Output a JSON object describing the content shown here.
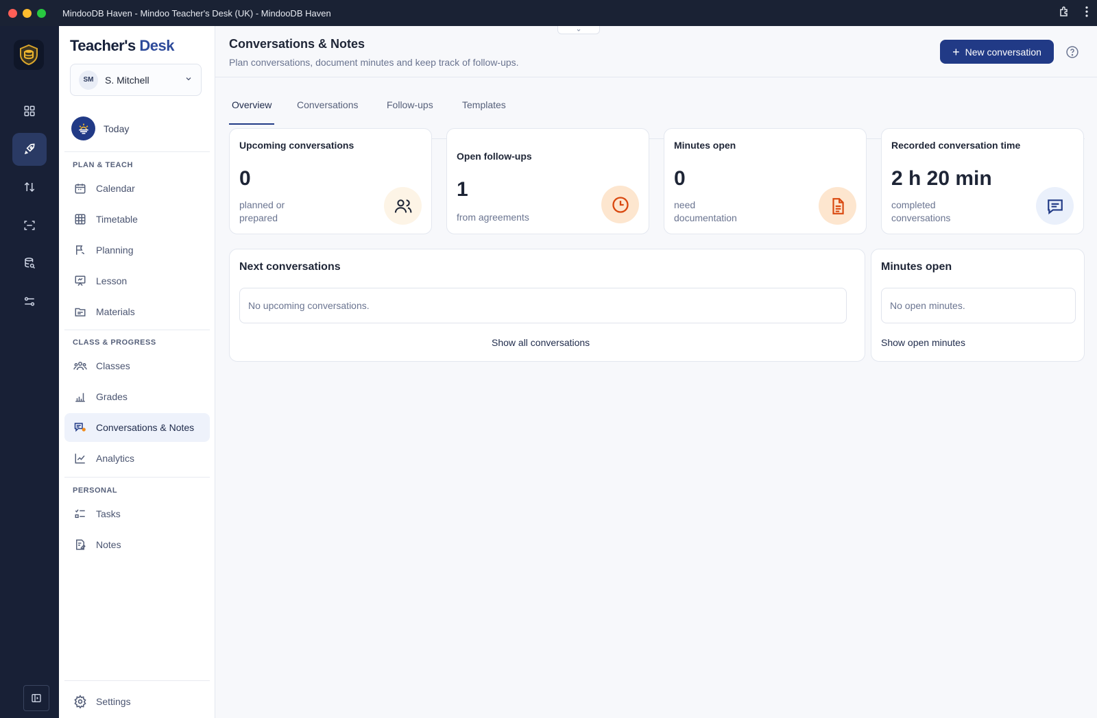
{
  "window": {
    "title": "MindooDB Haven - Mindoo Teacher's Desk (UK) - MindooDB Haven"
  },
  "brand": {
    "part1": "Teacher's",
    "part2": "Desk"
  },
  "user": {
    "initials": "SM",
    "name": "S. Mitchell"
  },
  "sidebar": {
    "today": "Today",
    "sections": {
      "plan": "PLAN & TEACH",
      "class": "CLASS & PROGRESS",
      "personal": "PERSONAL"
    },
    "plan_items": [
      "Calendar",
      "Timetable",
      "Planning",
      "Lesson",
      "Materials"
    ],
    "class_items": [
      "Classes",
      "Grades",
      "Conversations & Notes",
      "Analytics"
    ],
    "personal_items": [
      "Tasks",
      "Notes"
    ],
    "settings": "Settings"
  },
  "header": {
    "title": "Conversations & Notes",
    "subtitle": "Plan conversations, document minutes and keep track of follow-ups.",
    "new_button": "New conversation"
  },
  "tabs": [
    "Overview",
    "Conversations",
    "Follow-ups",
    "Templates"
  ],
  "stats": [
    {
      "label": "Upcoming conversations",
      "value": "0",
      "sub": "planned or prepared",
      "icon": "users-icon",
      "icon_color": "#1e2536",
      "icon_bg": "#fdf4e6"
    },
    {
      "label": "Open follow-ups",
      "value": "1",
      "sub": "from agreements",
      "icon": "clock-icon",
      "icon_color": "#d9480f",
      "icon_bg": "#fde6cf"
    },
    {
      "label": "Minutes open",
      "value": "0",
      "sub": "need documentation",
      "icon": "document-icon",
      "icon_color": "#d9480f",
      "icon_bg": "#fde6cf"
    },
    {
      "label": "Recorded conversation time",
      "value": "2 h 20 min",
      "sub": "completed conversations",
      "icon": "chat-icon",
      "icon_color": "#213a86",
      "icon_bg": "#eaf0fb"
    }
  ],
  "next_panel": {
    "title": "Next conversations",
    "empty": "No upcoming conversations.",
    "link": "Show all conversations"
  },
  "minutes_panel": {
    "title": "Minutes open",
    "empty": "No open minutes.",
    "link": "Show open minutes"
  }
}
